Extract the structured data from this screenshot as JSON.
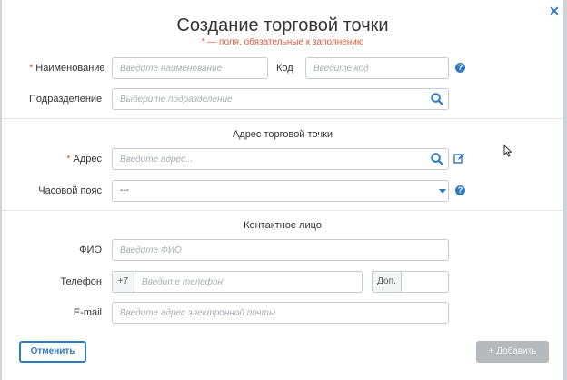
{
  "dialog": {
    "title": "Создание торговой точки",
    "subtitle": "* — поля, обязательные к заполнению",
    "close_icon": "close-icon"
  },
  "fields": {
    "name": {
      "required_mark": "*",
      "label": "Наименование",
      "placeholder": "Введите наименование"
    },
    "code": {
      "label": "Код",
      "placeholder": "Введите код"
    },
    "division": {
      "label": "Подразделение",
      "placeholder": "Выберите подразделение"
    }
  },
  "address_section": {
    "heading": "Адрес торговой точки",
    "address": {
      "required_mark": "*",
      "label": "Адрес",
      "placeholder": "Введите адрес..."
    },
    "timezone": {
      "label": "Часовой пояс",
      "value": "---"
    }
  },
  "contact_section": {
    "heading": "Контактное лицо",
    "fio": {
      "label": "ФИО",
      "placeholder": "Введите ФИО"
    },
    "phone": {
      "label": "Телефон",
      "prefix": "+7",
      "placeholder": "Введите телефон",
      "ext_label": "Доп."
    },
    "email": {
      "label": "E-mail",
      "placeholder": "Введите адрес электронной почты"
    }
  },
  "buttons": {
    "cancel": "Отменить",
    "add": "+ Добавить"
  },
  "help_glyph": "?",
  "colors": {
    "accent": "#2f7bbf",
    "required": "#e05a3a",
    "disabled_button": "#b7babd"
  }
}
